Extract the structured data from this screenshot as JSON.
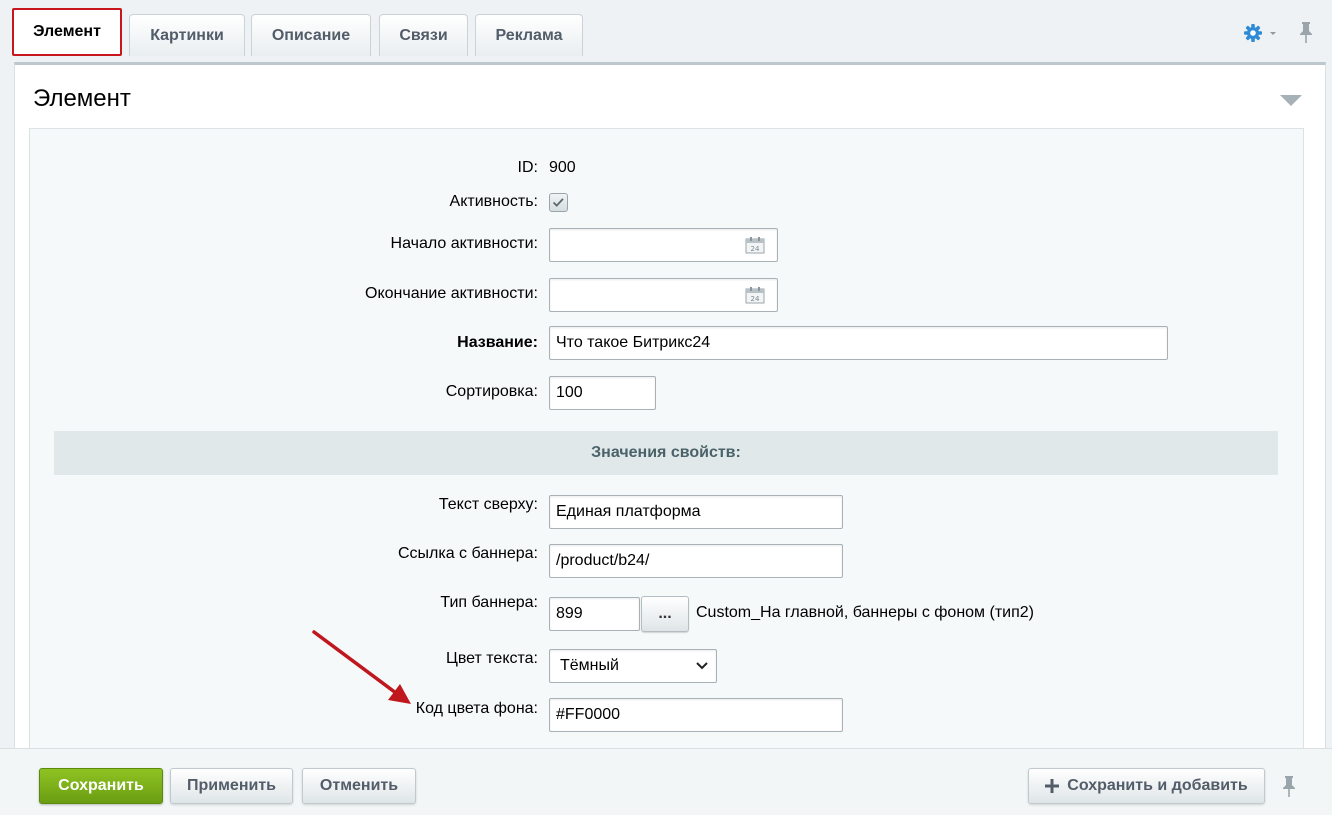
{
  "tabs": [
    {
      "label": "Элемент",
      "active": true
    },
    {
      "label": "Картинки",
      "active": false
    },
    {
      "label": "Описание",
      "active": false
    },
    {
      "label": "Связи",
      "active": false
    },
    {
      "label": "Реклама",
      "active": false
    }
  ],
  "panel": {
    "title": "Элемент"
  },
  "form": {
    "id": {
      "label": "ID:",
      "value": "900"
    },
    "active": {
      "label": "Активность:",
      "checked": true
    },
    "active_from": {
      "label": "Начало активности:",
      "value": ""
    },
    "active_to": {
      "label": "Окончание активности:",
      "value": ""
    },
    "name": {
      "label": "Название:",
      "value": "Что такое Битрикс24"
    },
    "sort": {
      "label": "Сортировка:",
      "value": "100"
    }
  },
  "properties": {
    "header": "Значения свойств:",
    "text_top": {
      "label": "Текст сверху:",
      "value": "Единая платформа"
    },
    "banner_link": {
      "label": "Ссылка с баннера:",
      "value": "/product/b24/"
    },
    "banner_type": {
      "label": "Тип баннера:",
      "value": "899",
      "button": "...",
      "description": "Custom_На главной, баннеры с фоном (тип2)"
    },
    "text_color": {
      "label": "Цвет текста:",
      "value": "Тёмный"
    },
    "bg_color_code": {
      "label": "Код цвета фона:",
      "value": "#FF0000"
    }
  },
  "buttons": {
    "save": "Сохранить",
    "apply": "Применить",
    "cancel": "Отменить",
    "save_and_add": "Сохранить и добавить"
  },
  "icons": {
    "settings": "gear-icon",
    "pin": "pin-icon",
    "collapse": "triangle-down-icon",
    "calendar": "calendar-icon",
    "plus": "plus-icon"
  },
  "colors": {
    "accent_green": "#7bb31a",
    "active_tab_border": "#c8161d",
    "annotation_arrow": "#c0161d",
    "settings_blue": "#2f8bd6"
  }
}
